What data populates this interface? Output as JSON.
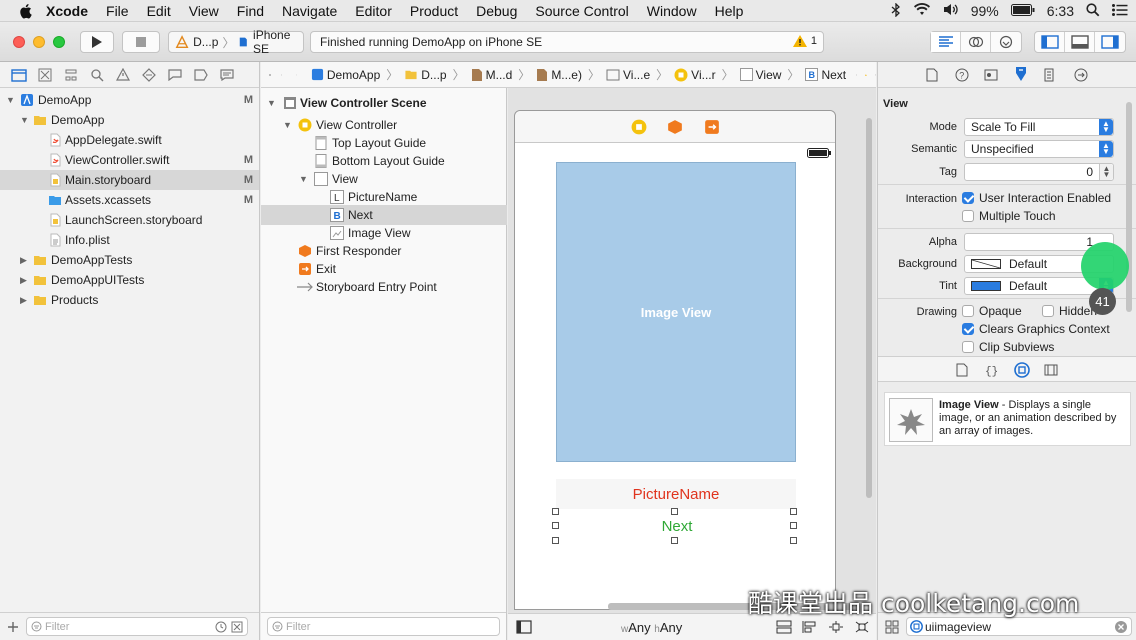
{
  "menubar": {
    "app": "Xcode",
    "items": [
      "File",
      "Edit",
      "View",
      "Find",
      "Navigate",
      "Editor",
      "Product",
      "Debug",
      "Source Control",
      "Window",
      "Help"
    ],
    "battery": "99%",
    "time": "6:33"
  },
  "toolbar": {
    "scheme": "D...p",
    "device": "iPhone SE",
    "status": "Finished running DemoApp on iPhone SE",
    "warnings": "1"
  },
  "navigator": {
    "files": [
      {
        "label": "DemoApp",
        "badge": "M",
        "indent": 0,
        "icon": "project-icon",
        "open": true
      },
      {
        "label": "DemoApp",
        "badge": "",
        "indent": 1,
        "icon": "folder-icon",
        "open": true
      },
      {
        "label": "AppDelegate.swift",
        "badge": "",
        "indent": 2,
        "icon": "swift-file-icon"
      },
      {
        "label": "ViewController.swift",
        "badge": "M",
        "indent": 2,
        "icon": "swift-file-icon"
      },
      {
        "label": "Main.storyboard",
        "badge": "M",
        "indent": 2,
        "icon": "storyboard-file-icon",
        "selected": true
      },
      {
        "label": "Assets.xcassets",
        "badge": "M",
        "indent": 2,
        "icon": "assets-folder-icon"
      },
      {
        "label": "LaunchScreen.storyboard",
        "badge": "",
        "indent": 2,
        "icon": "storyboard-file-icon"
      },
      {
        "label": "Info.plist",
        "badge": "",
        "indent": 2,
        "icon": "plist-file-icon"
      },
      {
        "label": "DemoAppTests",
        "badge": "",
        "indent": 1,
        "icon": "folder-icon",
        "open": false
      },
      {
        "label": "DemoAppUITests",
        "badge": "",
        "indent": 1,
        "icon": "folder-icon",
        "open": false
      },
      {
        "label": "Products",
        "badge": "",
        "indent": 1,
        "icon": "folder-icon",
        "open": false
      }
    ],
    "filter_placeholder": "Filter"
  },
  "jumpbar": {
    "crumbs": [
      "DemoApp",
      "D...p",
      "M...d",
      "M...e)",
      "Vi...e",
      "Vi...r",
      "View",
      "Next"
    ]
  },
  "outline": {
    "items": [
      {
        "label": "View Controller Scene",
        "indent": 0,
        "bold": true,
        "icon": "scene-icon",
        "open": true
      },
      {
        "label": "View Controller",
        "indent": 1,
        "icon": "view-controller-icon",
        "open": true
      },
      {
        "label": "Top Layout Guide",
        "indent": 2,
        "icon": "layout-guide-icon"
      },
      {
        "label": "Bottom Layout Guide",
        "indent": 2,
        "icon": "layout-guide-icon"
      },
      {
        "label": "View",
        "indent": 2,
        "icon": "view-icon",
        "open": true
      },
      {
        "label": "PictureName",
        "indent": 3,
        "icon": "label-icon"
      },
      {
        "label": "Next",
        "indent": 3,
        "icon": "button-icon",
        "selected": true
      },
      {
        "label": "Image View",
        "indent": 3,
        "icon": "image-view-icon"
      },
      {
        "label": "First Responder",
        "indent": 1,
        "icon": "first-responder-icon"
      },
      {
        "label": "Exit",
        "indent": 1,
        "icon": "exit-icon"
      },
      {
        "label": "Storyboard Entry Point",
        "indent": 1,
        "icon": "entry-point-arrow-icon"
      }
    ],
    "filter_placeholder": "Filter"
  },
  "canvas": {
    "image_view_label": "Image View",
    "picture_label": "PictureName",
    "next_button": "Next",
    "size_w": "w",
    "size_w_val": "Any",
    "size_h": "h",
    "size_h_val": "Any"
  },
  "inspector": {
    "section": "View",
    "mode_label": "Mode",
    "mode_value": "Scale To Fill",
    "semantic_label": "Semantic",
    "semantic_value": "Unspecified",
    "tag_label": "Tag",
    "tag_value": "0",
    "interaction_label": "Interaction",
    "user_interaction": "User Interaction Enabled",
    "multiple_touch": "Multiple Touch",
    "alpha_label": "Alpha",
    "alpha_value": "1",
    "background_label": "Background",
    "background_value": "Default",
    "tint_label": "Tint",
    "tint_value": "Default",
    "drawing_label": "Drawing",
    "opaque": "Opaque",
    "hidden": "Hidden",
    "clears": "Clears Graphics Context",
    "clip": "Clip Subviews",
    "library_title": "Image View",
    "library_desc": " - Displays a single image, or an animation described by an array of images.",
    "search_value": "uiimageview",
    "tap_count": "41"
  },
  "watermark": "酷课堂出品 coolketang.com",
  "colors": {
    "accent": "#2a7ce0",
    "image_view": "#a8cbe8",
    "label_red": "#e0341e",
    "next_green": "#2fa836",
    "touch": "#22d36a"
  }
}
